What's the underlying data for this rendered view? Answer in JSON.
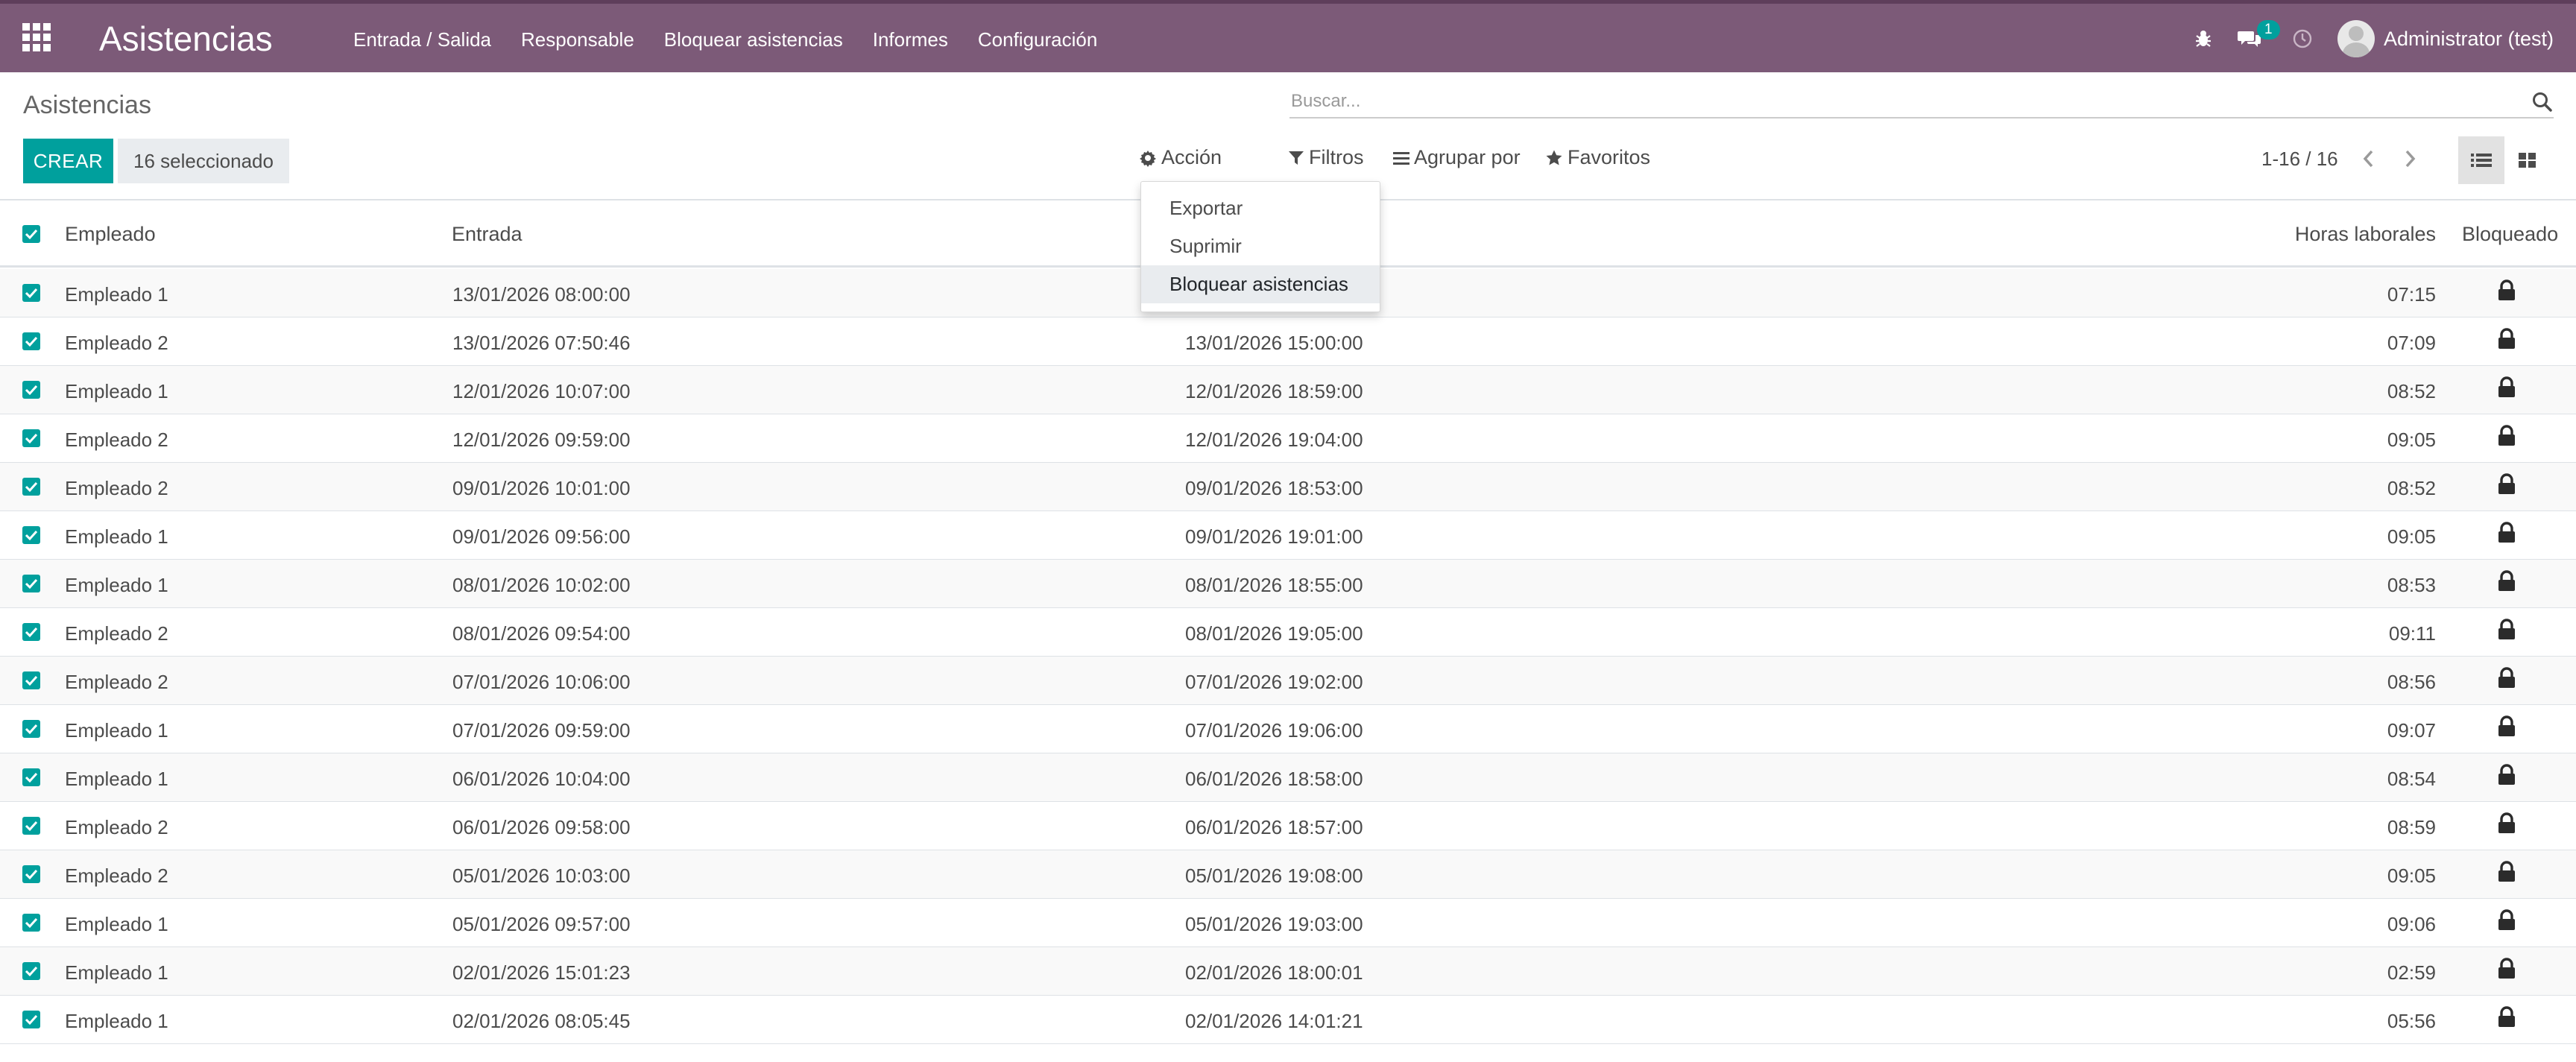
{
  "app": {
    "title": "Asistencias",
    "menu": [
      "Entrada / Salida",
      "Responsable",
      "Bloquear asistencias",
      "Informes",
      "Configuración"
    ],
    "messages_badge": "1",
    "user": "Administrator (test)",
    "accent_color": "#7c5a78",
    "primary_color": "#00a09d"
  },
  "control_panel": {
    "breadcrumb": "Asistencias",
    "search_placeholder": "Buscar...",
    "create_label": "CREAR",
    "selected_label": "16 seleccionado",
    "action_label": "Acción",
    "filters_label": "Filtros",
    "groupby_label": "Agrupar por",
    "favorites_label": "Favoritos",
    "pager": "1-16 / 16"
  },
  "action_menu": {
    "items": [
      "Exportar",
      "Suprimir",
      "Bloquear asistencias"
    ],
    "highlighted": "Bloquear asistencias"
  },
  "table": {
    "columns": {
      "employee": "Empleado",
      "check_in": "Entrada",
      "worked_hours": "Horas laborales",
      "locked": "Bloqueado"
    },
    "rows": [
      {
        "employee": "Empleado 1",
        "check_in": "13/01/2026 08:00:00",
        "check_out": "",
        "hours": "07:15"
      },
      {
        "employee": "Empleado 2",
        "check_in": "13/01/2026 07:50:46",
        "check_out": "13/01/2026 15:00:00",
        "hours": "07:09"
      },
      {
        "employee": "Empleado 1",
        "check_in": "12/01/2026 10:07:00",
        "check_out": "12/01/2026 18:59:00",
        "hours": "08:52"
      },
      {
        "employee": "Empleado 2",
        "check_in": "12/01/2026 09:59:00",
        "check_out": "12/01/2026 19:04:00",
        "hours": "09:05"
      },
      {
        "employee": "Empleado 2",
        "check_in": "09/01/2026 10:01:00",
        "check_out": "09/01/2026 18:53:00",
        "hours": "08:52"
      },
      {
        "employee": "Empleado 1",
        "check_in": "09/01/2026 09:56:00",
        "check_out": "09/01/2026 19:01:00",
        "hours": "09:05"
      },
      {
        "employee": "Empleado 1",
        "check_in": "08/01/2026 10:02:00",
        "check_out": "08/01/2026 18:55:00",
        "hours": "08:53"
      },
      {
        "employee": "Empleado 2",
        "check_in": "08/01/2026 09:54:00",
        "check_out": "08/01/2026 19:05:00",
        "hours": "09:11"
      },
      {
        "employee": "Empleado 2",
        "check_in": "07/01/2026 10:06:00",
        "check_out": "07/01/2026 19:02:00",
        "hours": "08:56"
      },
      {
        "employee": "Empleado 1",
        "check_in": "07/01/2026 09:59:00",
        "check_out": "07/01/2026 19:06:00",
        "hours": "09:07"
      },
      {
        "employee": "Empleado 1",
        "check_in": "06/01/2026 10:04:00",
        "check_out": "06/01/2026 18:58:00",
        "hours": "08:54"
      },
      {
        "employee": "Empleado 2",
        "check_in": "06/01/2026 09:58:00",
        "check_out": "06/01/2026 18:57:00",
        "hours": "08:59"
      },
      {
        "employee": "Empleado 2",
        "check_in": "05/01/2026 10:03:00",
        "check_out": "05/01/2026 19:08:00",
        "hours": "09:05"
      },
      {
        "employee": "Empleado 1",
        "check_in": "05/01/2026 09:57:00",
        "check_out": "05/01/2026 19:03:00",
        "hours": "09:06"
      },
      {
        "employee": "Empleado 1",
        "check_in": "02/01/2026 15:01:23",
        "check_out": "02/01/2026 18:00:01",
        "hours": "02:59"
      },
      {
        "employee": "Empleado 1",
        "check_in": "02/01/2026 08:05:45",
        "check_out": "02/01/2026 14:01:21",
        "hours": "05:56"
      }
    ]
  }
}
